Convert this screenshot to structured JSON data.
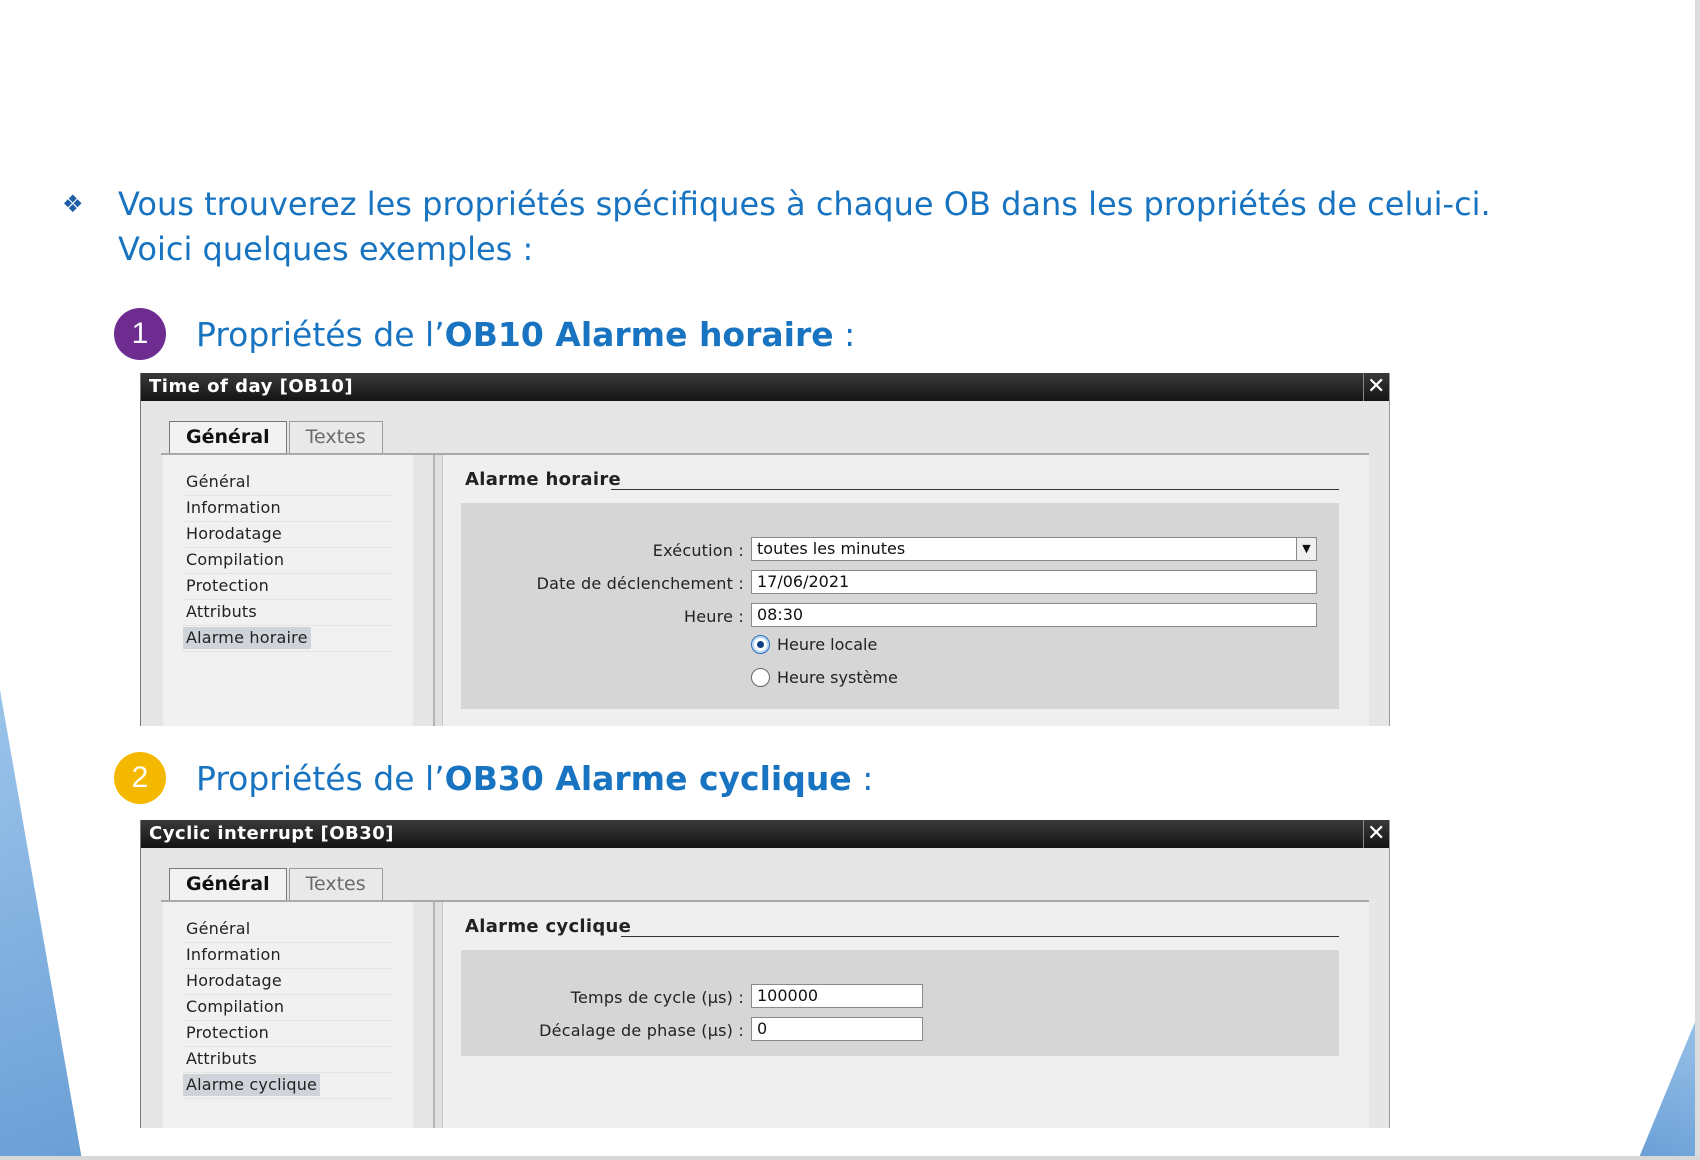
{
  "intro": {
    "line1": "Vous trouverez les propriétés spécifiques à chaque OB dans les propriétés de celui-ci.",
    "line2": "Voici quelques exemples :"
  },
  "steps": [
    {
      "number": "1",
      "prefix": "Propriétés de l’",
      "bold": "OB10 Alarme horaire",
      "suffix": " :",
      "color": "#6e2c91"
    },
    {
      "number": "2",
      "prefix": "Propriétés de l’",
      "bold": "OB30 Alarme cyclique",
      "suffix": " :",
      "color": "#f5b800"
    }
  ],
  "dialog1": {
    "title": "Time of day [OB10]",
    "tabs": [
      "Général",
      "Textes"
    ],
    "nav": [
      "Général",
      "Information",
      "Horodatage",
      "Compilation",
      "Protection",
      "Attributs",
      "Alarme horaire"
    ],
    "section": "Alarme horaire",
    "execution_label": "Exécution :",
    "execution_value": "toutes les minutes",
    "date_label": "Date de déclenchement :",
    "date_value": "17/06/2021",
    "heure_label": "Heure :",
    "heure_value": "08:30",
    "radio_local": "Heure locale",
    "radio_system": "Heure système"
  },
  "dialog2": {
    "title": "Cyclic interrupt [OB30]",
    "tabs": [
      "Général",
      "Textes"
    ],
    "nav": [
      "Général",
      "Information",
      "Horodatage",
      "Compilation",
      "Protection",
      "Attributs",
      "Alarme cyclique"
    ],
    "section": "Alarme cyclique",
    "cycle_label": "Temps de cycle (µs) :",
    "cycle_value": "100000",
    "phase_label": "Décalage de phase (µs) :",
    "phase_value": "0"
  }
}
